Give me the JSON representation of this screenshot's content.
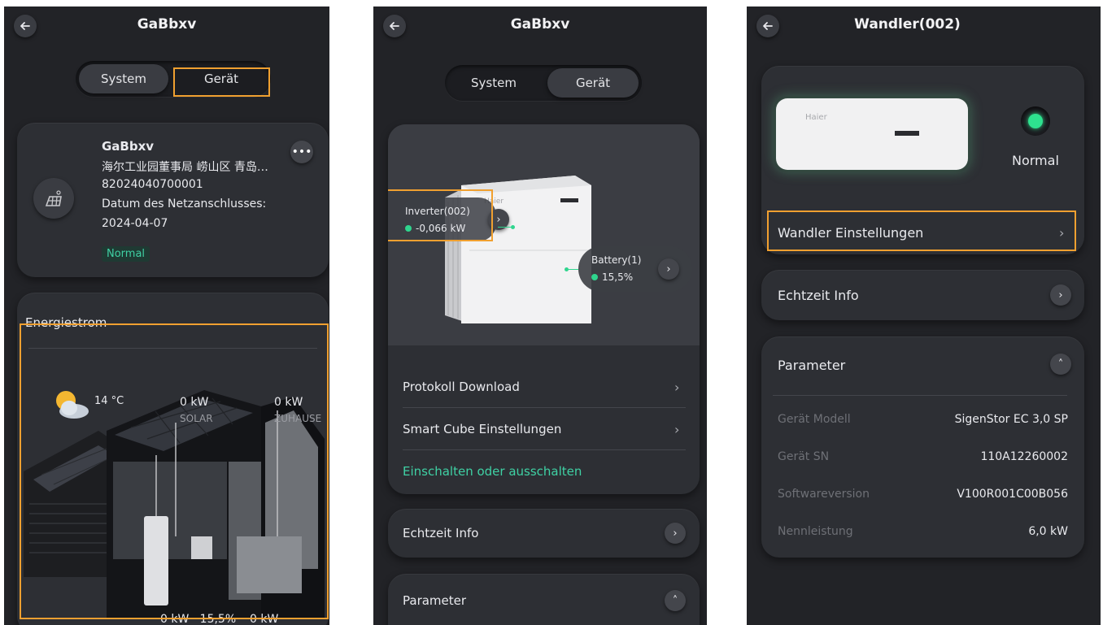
{
  "screen1": {
    "title": "GaBbxv",
    "tabs": {
      "system": "System",
      "device": "Gerät"
    },
    "station": {
      "name": "GaBbxv",
      "address": "海尔工业园董事局 崂山区 青岛…",
      "id": "82024040700001",
      "grid_label": "Datum des Netzanschlusses:",
      "grid_date": "2024-04-07",
      "status": "Normal"
    },
    "energy": {
      "title": "Energiestrom",
      "temperature": "14 °C",
      "solar_value": "0 kW",
      "solar_label": "SOLAR",
      "home_value": "0 kW",
      "home_label": "ZUHAUSE",
      "battery_value": "0 kW · 15,5%",
      "grid_value": "0 kW"
    }
  },
  "screen2": {
    "title": "GaBbxv",
    "tabs": {
      "system": "System",
      "device": "Gerät"
    },
    "inverter": {
      "label": "Inverter(002)",
      "value": "-0,066 kW"
    },
    "battery": {
      "label": "Battery(1)",
      "value": "15,5%"
    },
    "brand": "Haier",
    "menu": {
      "protocol": "Protokoll Download",
      "smart_cube": "Smart Cube Einstellungen",
      "power": "Einschalten oder ausschalten"
    },
    "realtime": "Echtzeit Info",
    "parameter": "Parameter"
  },
  "screen3": {
    "title": "Wandler(002)",
    "brand": "Haier",
    "status": "Normal",
    "settings": "Wandler Einstellungen",
    "realtime": "Echtzeit Info",
    "parameter": "Parameter",
    "params": [
      {
        "label": "Gerät Modell",
        "value": "SigenStor EC 3,0 SP"
      },
      {
        "label": "Gerät SN",
        "value": "110A12260002"
      },
      {
        "label": "Softwareversion",
        "value": "V100R001C00B056"
      },
      {
        "label": "Nennleistung",
        "value": "6,0 kW"
      }
    ]
  },
  "colors": {
    "accent_green": "#3fd1a4",
    "highlight": "#f0a030",
    "background": "#222327"
  }
}
